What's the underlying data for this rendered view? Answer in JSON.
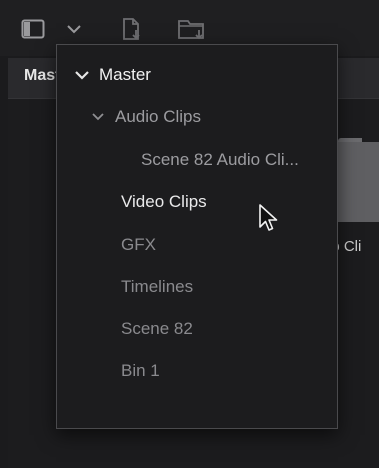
{
  "toolbar": {
    "icons": [
      "panel-toggle-icon",
      "chevron-down-icon",
      "import-media-icon",
      "import-folder-icon"
    ]
  },
  "bin_header": {
    "label": "Master"
  },
  "clip": {
    "label": "eo Cli"
  },
  "dropdown": {
    "items": [
      {
        "label": "Master",
        "level": 0,
        "expanded": true
      },
      {
        "label": "Audio Clips",
        "level": 1,
        "expanded": true
      },
      {
        "label": "Scene 82 Audio Cli...",
        "level": 2
      },
      {
        "label": "Video Clips",
        "level": 1,
        "hovered": true
      },
      {
        "label": "GFX",
        "level": 1
      },
      {
        "label": "Timelines",
        "level": 1
      },
      {
        "label": "Scene 82",
        "level": 1
      },
      {
        "label": "Bin 1",
        "level": 1
      }
    ]
  },
  "colors": {
    "background": "#1b1b1d",
    "dropdown_bg": "#1c1c1e",
    "dropdown_border": "#4a4a4d",
    "text_active": "#f2f2f2",
    "text_dim": "#8a8a8e"
  }
}
